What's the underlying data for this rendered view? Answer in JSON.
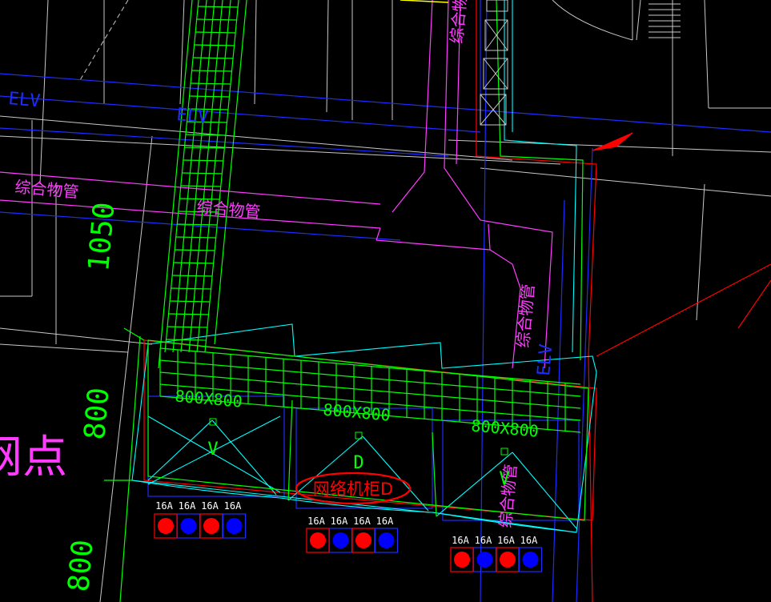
{
  "colors": {
    "background": "#000000",
    "white": "#c8c8c8",
    "green": "#00ff00",
    "magenta": "#ff3cff",
    "blue": "#1e2cff",
    "cyan": "#00ffff",
    "red": "#ff0000",
    "yellow": "#ffff00",
    "socket_red": "#ff0000",
    "socket_blue": "#0000ff"
  },
  "labels": {
    "elv_left": "ELV",
    "elv_mid": "ELV",
    "elv_right": "ELV",
    "pipe_left": "综合物管",
    "pipe_mid": "综合物管",
    "pipe_vertical_top": "综合物管",
    "pipe_vertical_mid": "综合物管",
    "pipe_vertical_bottom": "综合物管",
    "dim_1050": "1050",
    "dim_800_upper": "800",
    "dim_800_lower": "800",
    "network_point": "网点",
    "cabinet_label": "网络机柜D"
  },
  "cabinets": [
    {
      "size": "800X800",
      "letter": "V",
      "sockets": [
        "16A",
        "16A",
        "16A",
        "16A"
      ],
      "colors": [
        "socket_red",
        "socket_blue",
        "socket_red",
        "socket_blue"
      ]
    },
    {
      "size": "800X800",
      "letter": "D",
      "sockets": [
        "16A",
        "16A",
        "16A",
        "16A"
      ],
      "colors": [
        "socket_red",
        "socket_blue",
        "socket_red",
        "socket_blue"
      ]
    },
    {
      "size": "800X800",
      "letter": "V",
      "sockets": [
        "16A",
        "16A",
        "16A",
        "16A"
      ],
      "colors": [
        "socket_red",
        "socket_blue",
        "socket_red",
        "socket_blue"
      ]
    }
  ]
}
